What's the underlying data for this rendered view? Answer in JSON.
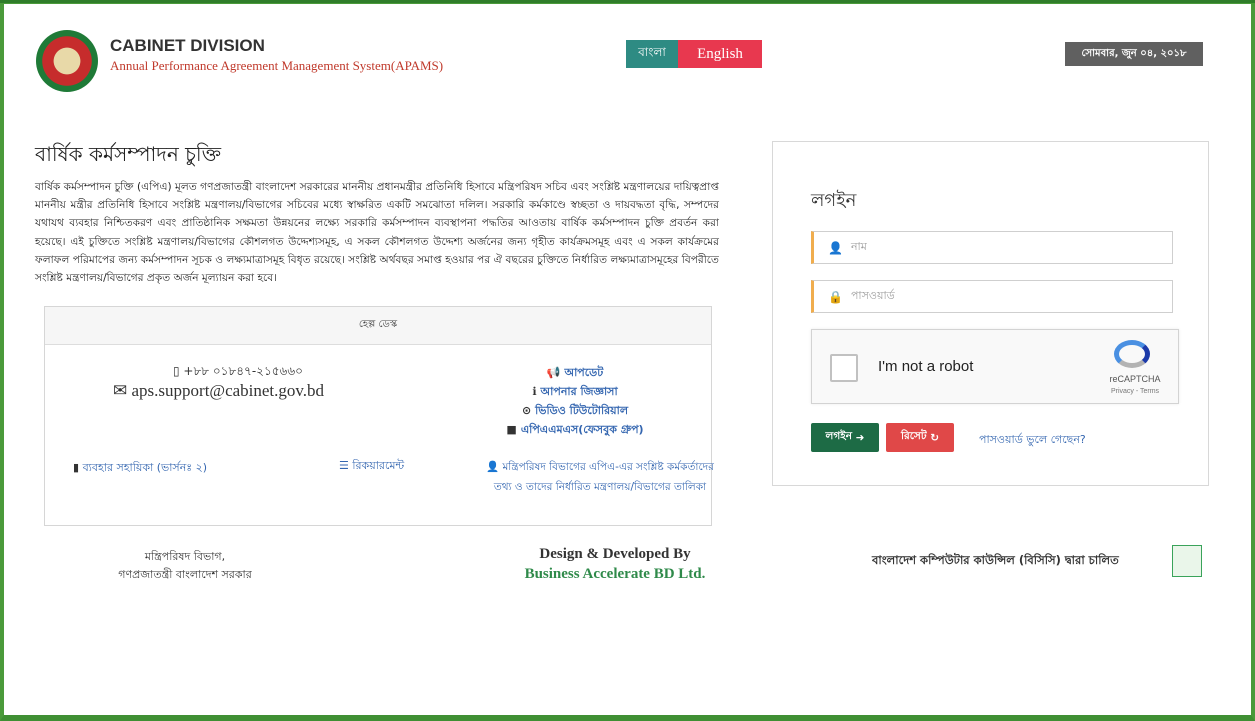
{
  "header": {
    "title": "CABINET DIVISION",
    "subtitle": "Annual Performance Agreement Management System(APAMS)",
    "lang_bn": "বাংলা",
    "lang_en": "English",
    "date": "সোমবার, জুন ০৪, ২০১৮"
  },
  "intro": {
    "title": "বার্ষিক কর্মসম্পাদন চুক্তি",
    "body": "বার্ষিক কর্মসম্পাদন চুক্তি (এপিএ) মূলত গণপ্রজাতন্ত্রী বাংলাদেশ সরকারের মাননীয় প্রধানমন্ত্রীর প্রতিনিধি হিসাবে মন্ত্রিপরিষদ সচিব এবং সংশ্লিষ্ট মন্ত্রণালয়ের দায়িত্বপ্রাপ্ত মাননীয় মন্ত্রীর প্রতিনিধি হিসাবে সংশ্লিষ্ট মন্ত্রণালয়/বিভাগের সচিবের মধ্যে স্বাক্ষরিত একটি সমঝোতা দলিল। সরকারি কর্মকাণ্ডে স্বচ্ছতা ও দায়বদ্ধতা বৃদ্ধি, সম্পদের যথাযথ ব্যবহার নিশ্চিতকরণ এবং প্রাতিষ্ঠানিক সক্ষমতা উন্নয়নের লক্ষ্যে সরকারি কর্মসম্পাদন ব্যবস্থাপনা পদ্ধতির আওতায় বার্ষিক কর্মসম্পাদন চুক্তি প্রবর্তন করা হয়েছে। এই চুক্তিতে সংশ্লিষ্ট মন্ত্রণালয়/বিভাগের কৌশলগত উদ্দেশ্যসমূহ, এ সকল কৌশলগত উদ্দেশ্য অর্জনের জন্য গৃহীত কার্যক্রমসমূহ এবং এ সকল কার্যক্রমের ফলাফল পরিমাপের জন্য কর্মসম্পাদন সূচক ও লক্ষ্যমাত্রাসমূহ বিধৃত রয়েছে। সংশ্লিষ্ট অর্থবছর সমাপ্ত হওয়ার পর ঐ বছরের চুক্তিতে নির্ধারিত লক্ষ্যমাত্রাসমূহের বিপরীতে সংশ্লিষ্ট মন্ত্রণালয়/বিভাগের প্রকৃত অর্জন মূল্যায়ন করা হবে।"
  },
  "help": {
    "heading": "হেল্প ডেস্ক",
    "phone": "+৮৮ ০১৮৪৭-২১৫৬৬০",
    "email": "aps.support@cabinet.gov.bd",
    "links": [
      "আপডেট",
      "আপনার জিজ্ঞাসা",
      "ভিডিও টিউটোরিয়াল",
      "এপিএএমএস(ফেসবুক গ্রুপ)"
    ],
    "guide": "ব্যবহার সহায়িকা (ভার্সনঃ ২)",
    "requirement": "রিকয়ারমেন্ট",
    "officers": "মন্ত্রিপরিষদ বিভাগের এপিএ-এর সংশ্লিষ্ট কর্মকর্তাদের তথ্য ও তাদের নির্ধারিত মন্ত্রণালয়/বিভাগের তালিকা"
  },
  "footer": {
    "left_line1": "মন্ত্রিপরিষদ বিভাগ,",
    "left_line2": "গণপ্রজাতন্ত্রী বাংলাদেশ সরকার",
    "dev_line1": "Design & Developed By",
    "dev_line2": "Business Accelerate BD Ltd.",
    "right": "বাংলাদেশ কম্পিউটার কাউন্সিল (বিসিসি) দ্বারা চালিত"
  },
  "login": {
    "title": "লগইন",
    "name_placeholder": "নাম",
    "password_placeholder": "পাসওয়ার্ড",
    "captcha_text": "I'm not a robot",
    "captcha_brand": "reCAPTCHA",
    "captcha_links": "Privacy - Terms",
    "login_button": "লগইন",
    "reset_button": "রিসেট",
    "forgot": "পাসওয়ার্ড ভুলে গেছেন?"
  }
}
